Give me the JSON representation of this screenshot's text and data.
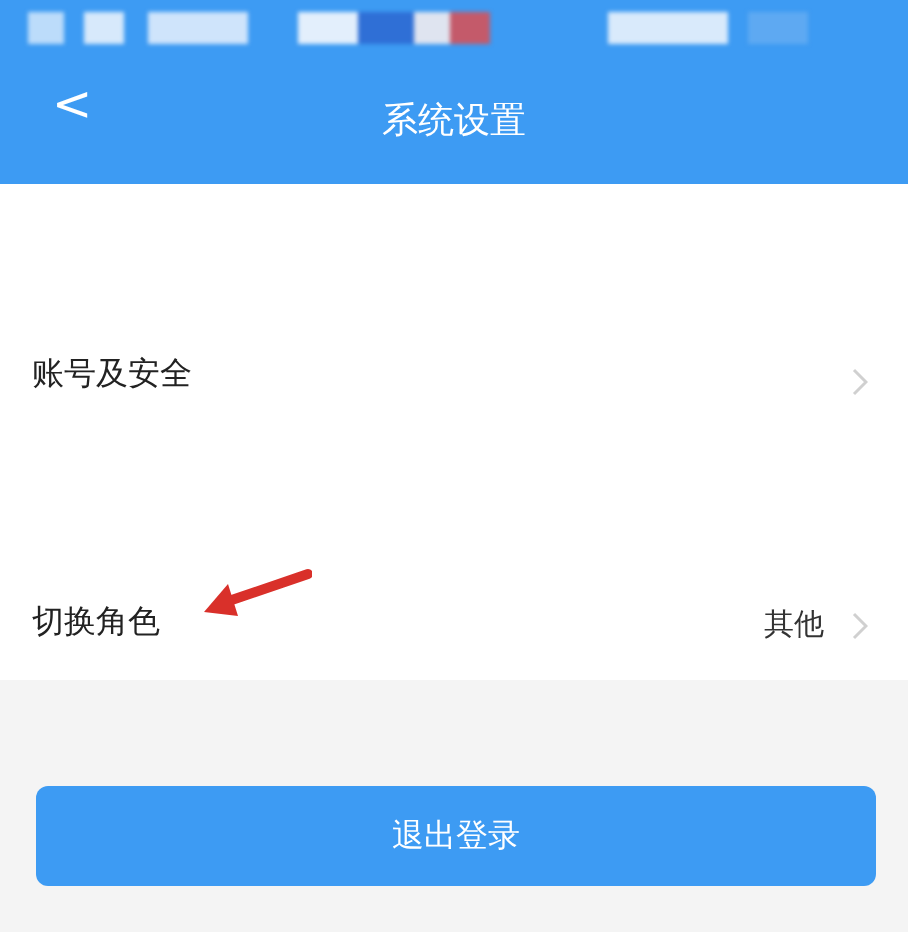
{
  "nav_bar": {
    "back": "<",
    "title": "系统设置"
  },
  "settings": [
    {
      "label": "账号及安全"
    },
    {
      "label": "切换角色",
      "value": "其他"
    }
  ],
  "logout_button": {
    "label": "退出登录"
  }
}
